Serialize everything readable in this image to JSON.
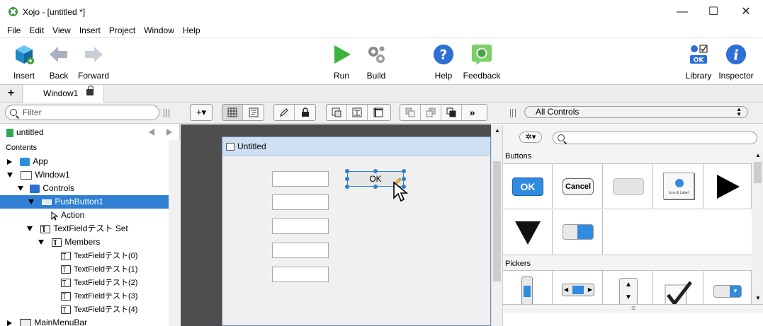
{
  "window": {
    "title": "Xojo - [untitled *]",
    "minimize": "—",
    "maximize": "☐",
    "close": "✕"
  },
  "menu": [
    "File",
    "Edit",
    "View",
    "Insert",
    "Project",
    "Window",
    "Help"
  ],
  "toolbar": {
    "insert": "Insert",
    "back": "Back",
    "forward": "Forward",
    "run": "Run",
    "build": "Build",
    "help": "Help",
    "feedback": "Feedback",
    "library": "Library",
    "inspector": "Inspector"
  },
  "tabs": {
    "add": "+",
    "active": "Window1"
  },
  "filter": {
    "placeholder": "Filter"
  },
  "library_picker": {
    "selected": "All Controls"
  },
  "navigator": {
    "project": "untitled",
    "section": "Contents",
    "items": [
      {
        "label": "App"
      },
      {
        "label": "Window1"
      },
      {
        "label": "Controls"
      },
      {
        "label": "PushButton1"
      },
      {
        "label": "Action"
      },
      {
        "label": "TextFieldテスト Set"
      },
      {
        "label": "Members"
      },
      {
        "label": "TextFieldテスト(0)"
      },
      {
        "label": "TextFieldテスト(1)"
      },
      {
        "label": "TextFieldテスト(2)"
      },
      {
        "label": "TextFieldテスト(3)"
      },
      {
        "label": "TextFieldテスト(4)"
      },
      {
        "label": "MainMenuBar"
      }
    ]
  },
  "design": {
    "window_title": "Untitled",
    "ok_button": "OK"
  },
  "library": {
    "sections": [
      "Buttons",
      "Pickers"
    ],
    "ok": "OK",
    "cancel": "Cancel",
    "icon_label": "Icon & Label"
  },
  "colors": {
    "selection": "#2f7fd2",
    "run_green": "#3bb33b",
    "help_blue": "#2c6fd6",
    "canvas": "#4e4e4e"
  }
}
